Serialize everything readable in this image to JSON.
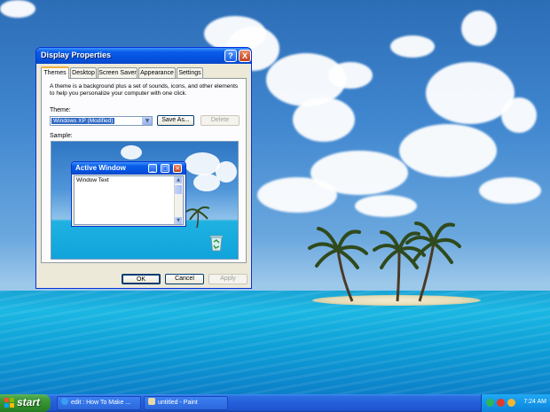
{
  "dialog": {
    "title": "Display Properties",
    "help_label": "?",
    "close_label": "X",
    "tabs": [
      {
        "label": "Themes",
        "active": true
      },
      {
        "label": "Desktop",
        "active": false
      },
      {
        "label": "Screen Saver",
        "active": false
      },
      {
        "label": "Appearance",
        "active": false
      },
      {
        "label": "Settings",
        "active": false
      }
    ],
    "description": "A theme is a background plus a set of sounds, icons, and other elements to help you personalize your computer with one click.",
    "theme_label": "Theme:",
    "theme_value": "Windows XP (Modified)",
    "save_as_label": "Save As...",
    "delete_label": "Delete",
    "sample_label": "Sample:",
    "sample": {
      "window_title": "Active Window",
      "window_text": "Window Text"
    },
    "ok_label": "OK",
    "cancel_label": "Cancel",
    "apply_label": "Apply"
  },
  "taskbar": {
    "start_label": "start",
    "tasks": [
      {
        "label": "edit : How To Make ...",
        "icon": "internet-explorer-icon"
      },
      {
        "label": "untitled - Paint",
        "icon": "paint-icon"
      }
    ],
    "clock": "7:24 AM"
  },
  "colors": {
    "xp_blue": "#0553e1",
    "start_green": "#3c9a3a",
    "dialog_face": "#ece9d8"
  }
}
